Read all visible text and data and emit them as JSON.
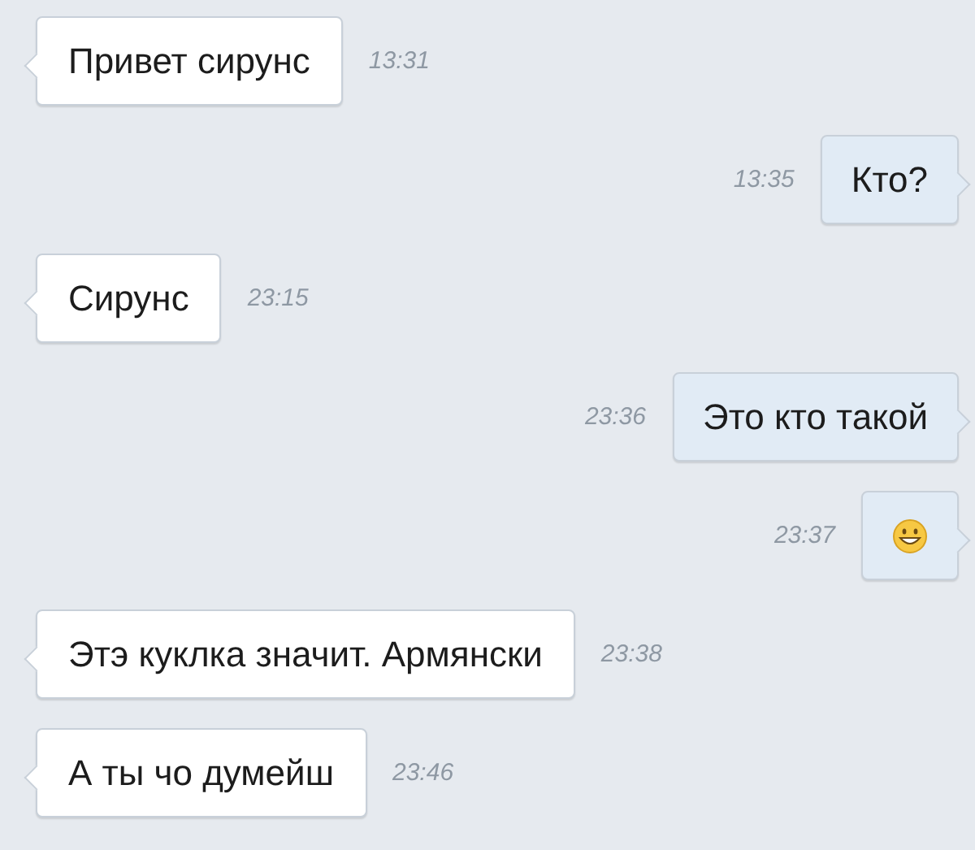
{
  "messages": [
    {
      "outgoing": false,
      "kind": "text",
      "text": "Привет сирунс",
      "time": "13:31"
    },
    {
      "outgoing": true,
      "kind": "text",
      "text": "Кто?",
      "time": "13:35"
    },
    {
      "outgoing": false,
      "kind": "text",
      "text": "Сирунс",
      "time": "23:15"
    },
    {
      "outgoing": true,
      "kind": "text",
      "text": "Это кто такой",
      "time": "23:36"
    },
    {
      "outgoing": true,
      "kind": "emoji",
      "time": "23:37"
    },
    {
      "outgoing": false,
      "kind": "text",
      "text": "Этэ куклка значит. Армянски",
      "time": "23:38"
    },
    {
      "outgoing": false,
      "kind": "text",
      "text": "А ты чо думейш",
      "time": "23:46"
    }
  ]
}
